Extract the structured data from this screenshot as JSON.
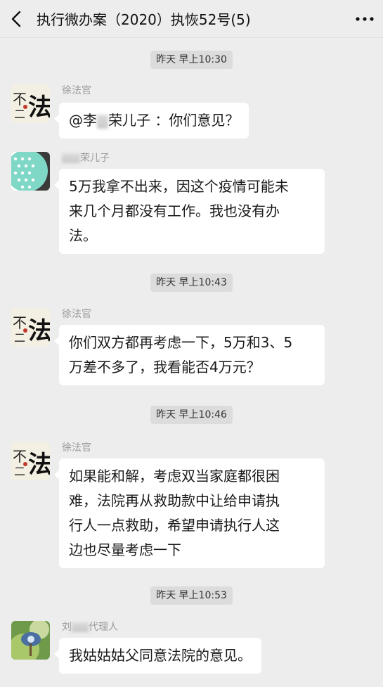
{
  "header": {
    "title": "执行微办案（2020）执恢52号(5)"
  },
  "messages": [
    {
      "time": "昨天 早上10:30"
    },
    {
      "sender": "徐法官",
      "text": "@李　荣儿子 ：你们意见？"
    },
    {
      "sender": "李　荣儿子",
      "text": "5万我拿不出来，因这个疫情可能未来几个月都没有工作。我也没有办法。"
    },
    {
      "time": "昨天 早上10:43"
    },
    {
      "sender": "徐法官",
      "text": "你们双方都再考虑一下，5万和3、5万差不多了，我看能否4万元？"
    },
    {
      "time": "昨天 早上10:46"
    },
    {
      "sender": "徐法官",
      "text": "如果能和解，考虑双当家庭都很困难，法院再从救助款中让给申请执行人一点救助，希望申请执行人这边也尽量考虑一下"
    },
    {
      "time": "昨天 早上10:53"
    },
    {
      "sender": "刘　代理人",
      "text": "我姑姑姑父同意法院的意见。"
    }
  ],
  "chat": {
    "t1": "昨天 早上10:30",
    "m1_sender": "徐法官",
    "m1_prefix": "@李",
    "m1_suffix": "荣儿子 ：你们意见？",
    "m2_sender_suffix": "荣儿子",
    "m2_line1": "5万我拿不出来，因这个疫情可能未",
    "m2_line2": "来几个月都没有工作。我也没有办",
    "m2_line3": "法。",
    "t2": "昨天 早上10:43",
    "m3_sender": "徐法官",
    "m3_line1": "你们双方都再考虑一下，5万和3、5",
    "m3_line2": "万差不多了，我看能否4万元？",
    "t3": "昨天 早上10:46",
    "m4_sender": "徐法官",
    "m4_line1": "如果能和解，考虑双当家庭都很困",
    "m4_line2": "难，法院再从救助款中让给申请执",
    "m4_line3": "行人一点救助，希望申请执行人这",
    "m4_line4": "边也尽量考虑一下",
    "t4": "昨天 早上10:53",
    "m5_sender_prefix": "刘",
    "m5_sender_suffix": "代理人",
    "m5_text": "我姑姑姑父同意法院的意见。"
  },
  "colors": {
    "background": "#ededed",
    "bubble": "#ffffff",
    "time_pill": "#dcdcdc",
    "sender_name": "#9a9a9a"
  },
  "icons": {
    "back": "chevron-left-icon",
    "more": "more-dots-icon"
  }
}
